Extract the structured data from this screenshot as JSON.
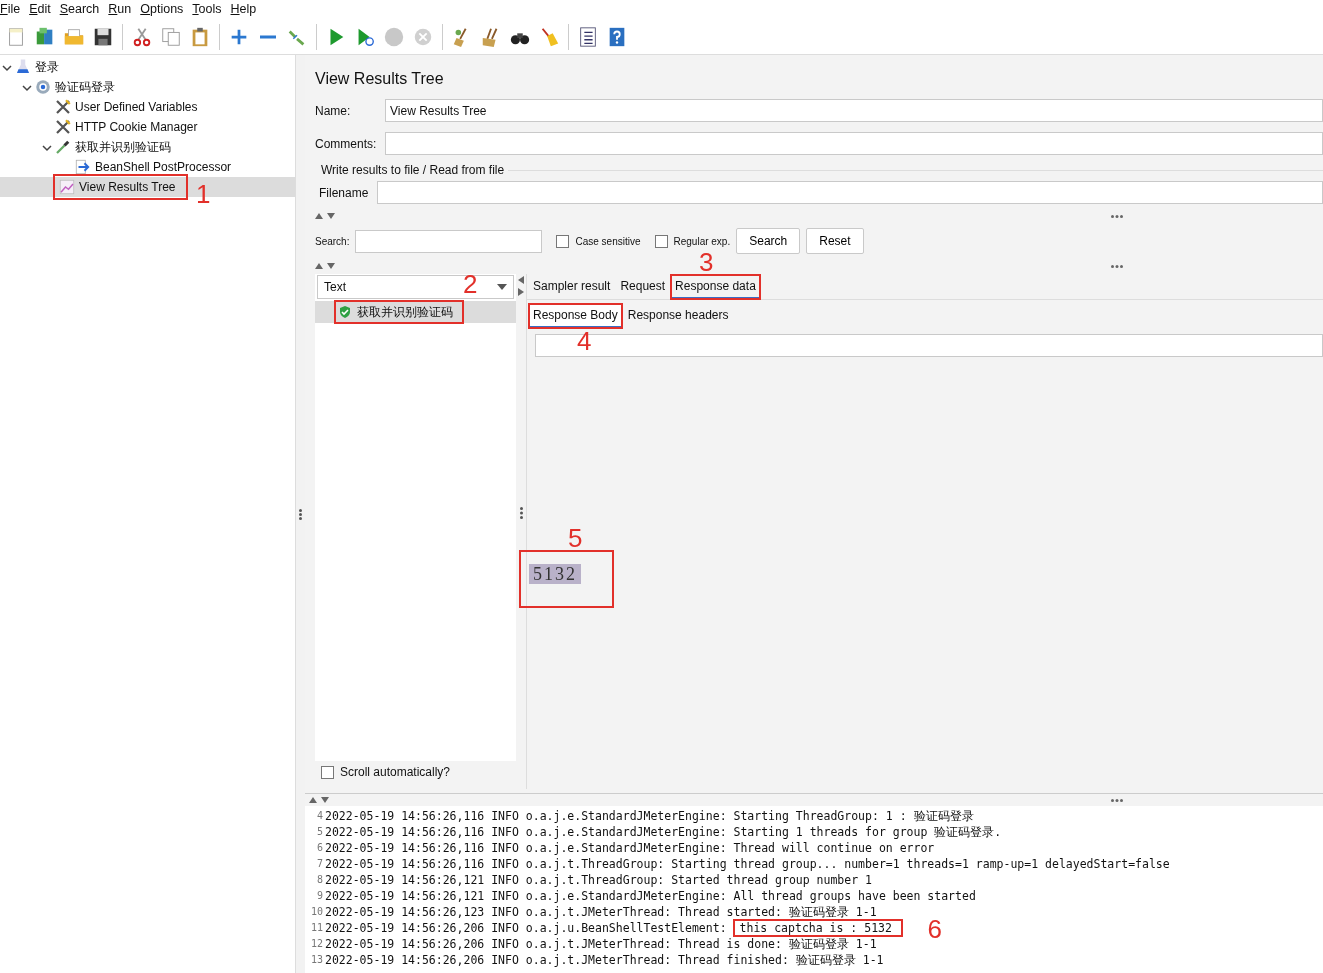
{
  "menu": [
    "File",
    "Edit",
    "Search",
    "Run",
    "Options",
    "Tools",
    "Help"
  ],
  "tree": [
    {
      "label": "登录",
      "kind": "test_plan",
      "expanded": true,
      "selected": false,
      "children": [
        {
          "label": "验证码登录",
          "kind": "thread_group",
          "expanded": true,
          "selected": false,
          "children": [
            {
              "label": "User Defined Variables",
              "kind": "config",
              "selected": false
            },
            {
              "label": "HTTP Cookie Manager",
              "kind": "config",
              "selected": false
            },
            {
              "label": "获取并识别验证码",
              "kind": "sampler",
              "expanded": true,
              "selected": false,
              "children": [
                {
                  "label": "BeanShell PostProcessor",
                  "kind": "post_processor",
                  "selected": false
                }
              ]
            },
            {
              "label": "View Results Tree",
              "kind": "listener",
              "selected": true,
              "annotation": "1"
            }
          ]
        }
      ]
    }
  ],
  "panel": {
    "title": "View Results Tree",
    "name_label": "Name:",
    "name_value": "View Results Tree",
    "comments_label": "Comments:",
    "file_group": "Write results to file / Read from file",
    "filename_label": "Filename"
  },
  "search": {
    "label": "Search:",
    "options": [
      {
        "label": "Case sensitive",
        "checked": false
      },
      {
        "label": "Regular exp.",
        "checked": false
      }
    ],
    "buttons": [
      "Search",
      "Reset"
    ]
  },
  "renderer": "Text",
  "results": [
    {
      "label": "获取并识别验证码",
      "passed": true,
      "selected": true,
      "annotation": "2"
    }
  ],
  "scroll_auto": {
    "label": "Scroll automatically?",
    "checked": false
  },
  "tabs": [
    {
      "label": "Sampler result",
      "selected": false
    },
    {
      "label": "Request",
      "selected": false
    },
    {
      "label": "Response data",
      "selected": true,
      "annotation": "3"
    }
  ],
  "subtabs": [
    {
      "label": "Response Body",
      "selected": true,
      "annotation": "4"
    },
    {
      "label": "Response headers",
      "selected": false
    }
  ],
  "response_image": {
    "text": "5132",
    "annotation": "5"
  },
  "log": [
    {
      "n": "4",
      "text": "2022-05-19 14:56:26,116 INFO o.a.j.e.StandardJMeterEngine: Starting ThreadGroup: 1 : 验证码登录"
    },
    {
      "n": "5",
      "text": "2022-05-19 14:56:26,116 INFO o.a.j.e.StandardJMeterEngine: Starting 1 threads for group 验证码登录."
    },
    {
      "n": "6",
      "text": "2022-05-19 14:56:26,116 INFO o.a.j.e.StandardJMeterEngine: Thread will continue on error"
    },
    {
      "n": "7",
      "text": "2022-05-19 14:56:26,116 INFO o.a.j.t.ThreadGroup: Starting thread group... number=1 threads=1 ramp-up=1 delayedStart=false"
    },
    {
      "n": "8",
      "text": "2022-05-19 14:56:26,121 INFO o.a.j.t.ThreadGroup: Started thread group number 1"
    },
    {
      "n": "9",
      "text": "2022-05-19 14:56:26,121 INFO o.a.j.e.StandardJMeterEngine: All thread groups have been started"
    },
    {
      "n": "10",
      "text": "2022-05-19 14:56:26,123 INFO o.a.j.t.JMeterThread: Thread started: 验证码登录 1-1"
    },
    {
      "n": "11",
      "text": "2022-05-19 14:56:26,206 INFO o.a.j.u.BeanShellTestElement:",
      "boxed": "this captcha is : 5132",
      "annotation": "6"
    },
    {
      "n": "12",
      "text": "2022-05-19 14:56:26,206 INFO o.a.j.t.JMeterThread: Thread is done: 验证码登录 1-1"
    },
    {
      "n": "13",
      "text": "2022-05-19 14:56:26,206 INFO o.a.j.t.JMeterThread: Thread finished: 验证码登录 1-1"
    }
  ]
}
